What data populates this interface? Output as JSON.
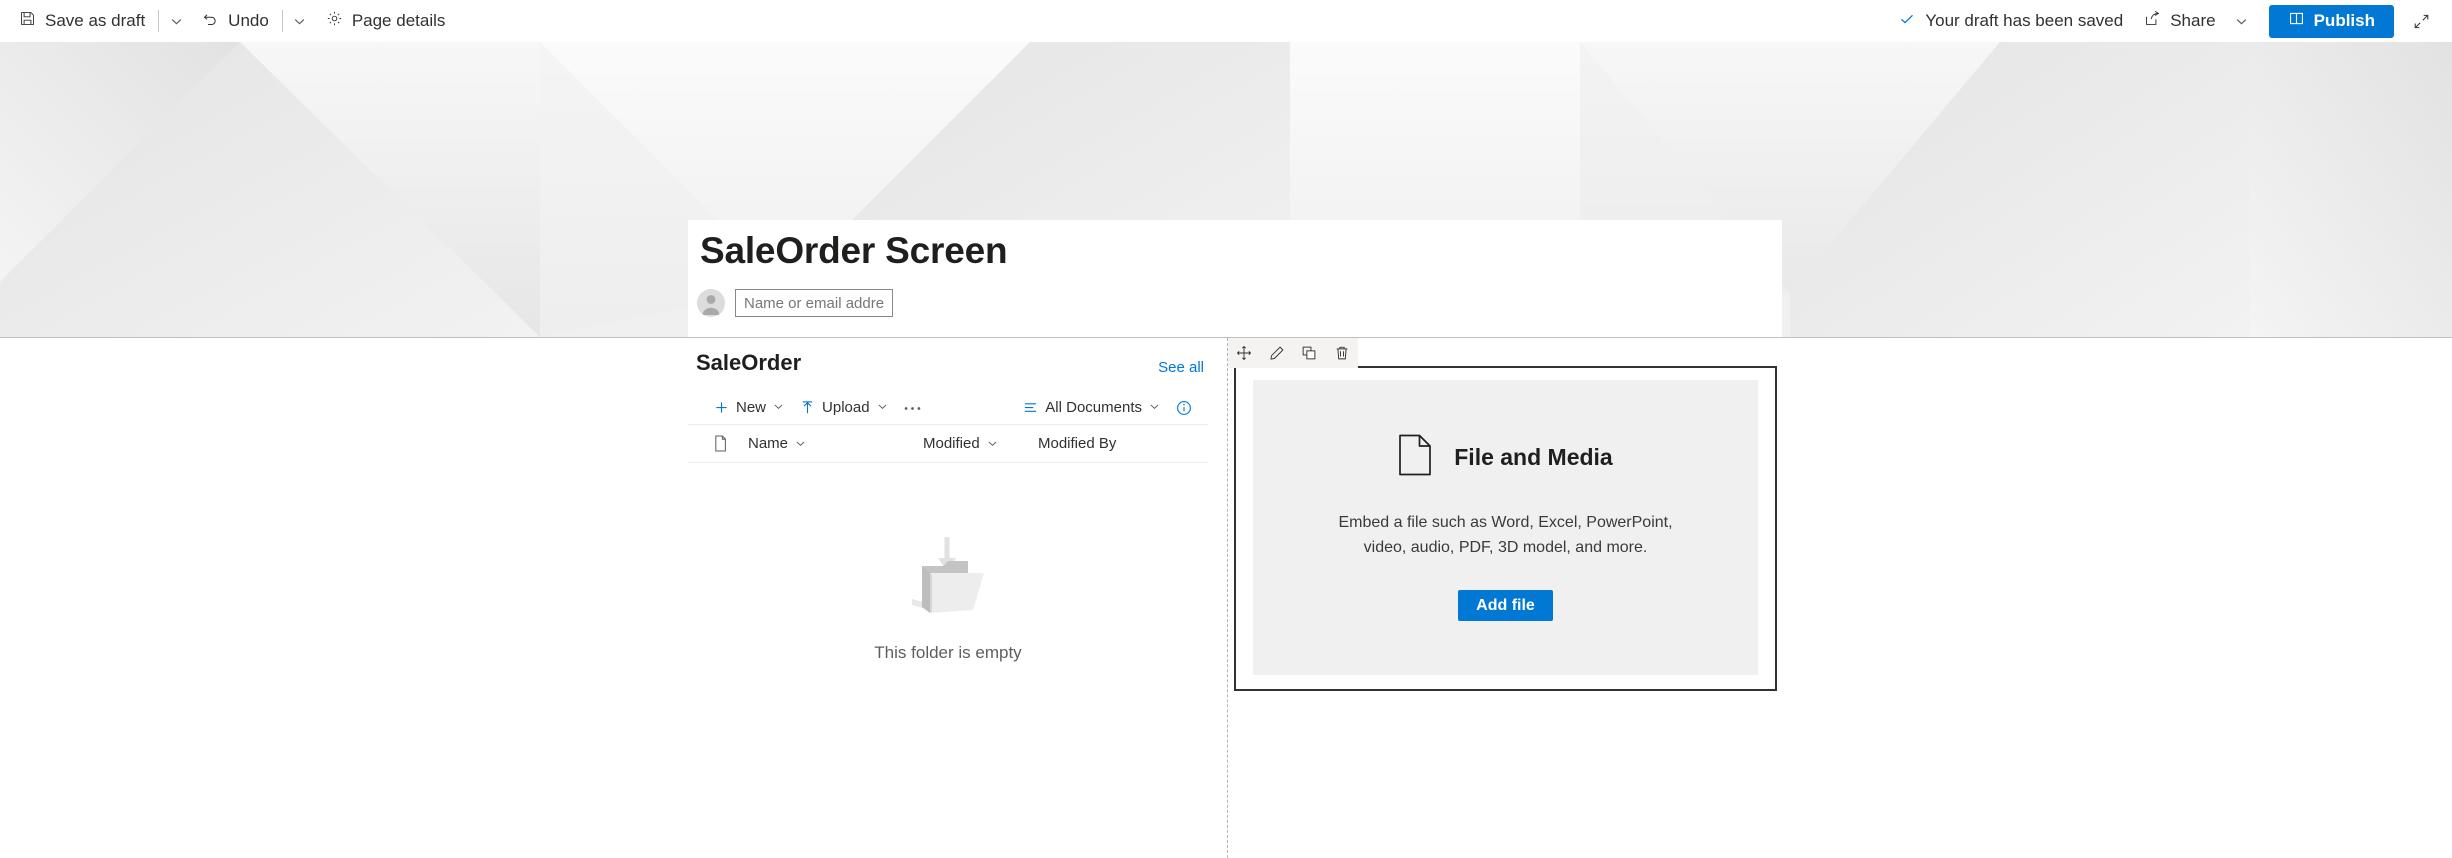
{
  "command_bar": {
    "save_as_draft": "Save as draft",
    "undo": "Undo",
    "page_details": "Page details",
    "saved_status": "Your draft has been saved",
    "share": "Share",
    "publish": "Publish"
  },
  "page": {
    "title": "SaleOrder Screen",
    "author_placeholder": "Name or email address",
    "author_value": ""
  },
  "document_library": {
    "title": "SaleOrder",
    "see_all": "See all",
    "commands": {
      "new": "New",
      "upload": "Upload",
      "more": "•••",
      "view": "All Documents"
    },
    "columns": [
      "Name",
      "Modified",
      "Modified By"
    ],
    "rows": [],
    "empty_message": "This folder is empty"
  },
  "file_media_webpart": {
    "title": "File and Media",
    "description": "Embed a file such as Word, Excel, PowerPoint, video, audio, PDF, 3D model, and more.",
    "add_file": "Add file",
    "toolbar": {
      "move": "Move web part",
      "edit": "Edit web part",
      "duplicate": "Duplicate web part",
      "delete": "Delete web part"
    }
  },
  "colors": {
    "accent": "#0078d4",
    "text": "#323130",
    "webpart_bg": "#f0f0f0",
    "selected_border": "#323130",
    "banner": "#efefef"
  }
}
